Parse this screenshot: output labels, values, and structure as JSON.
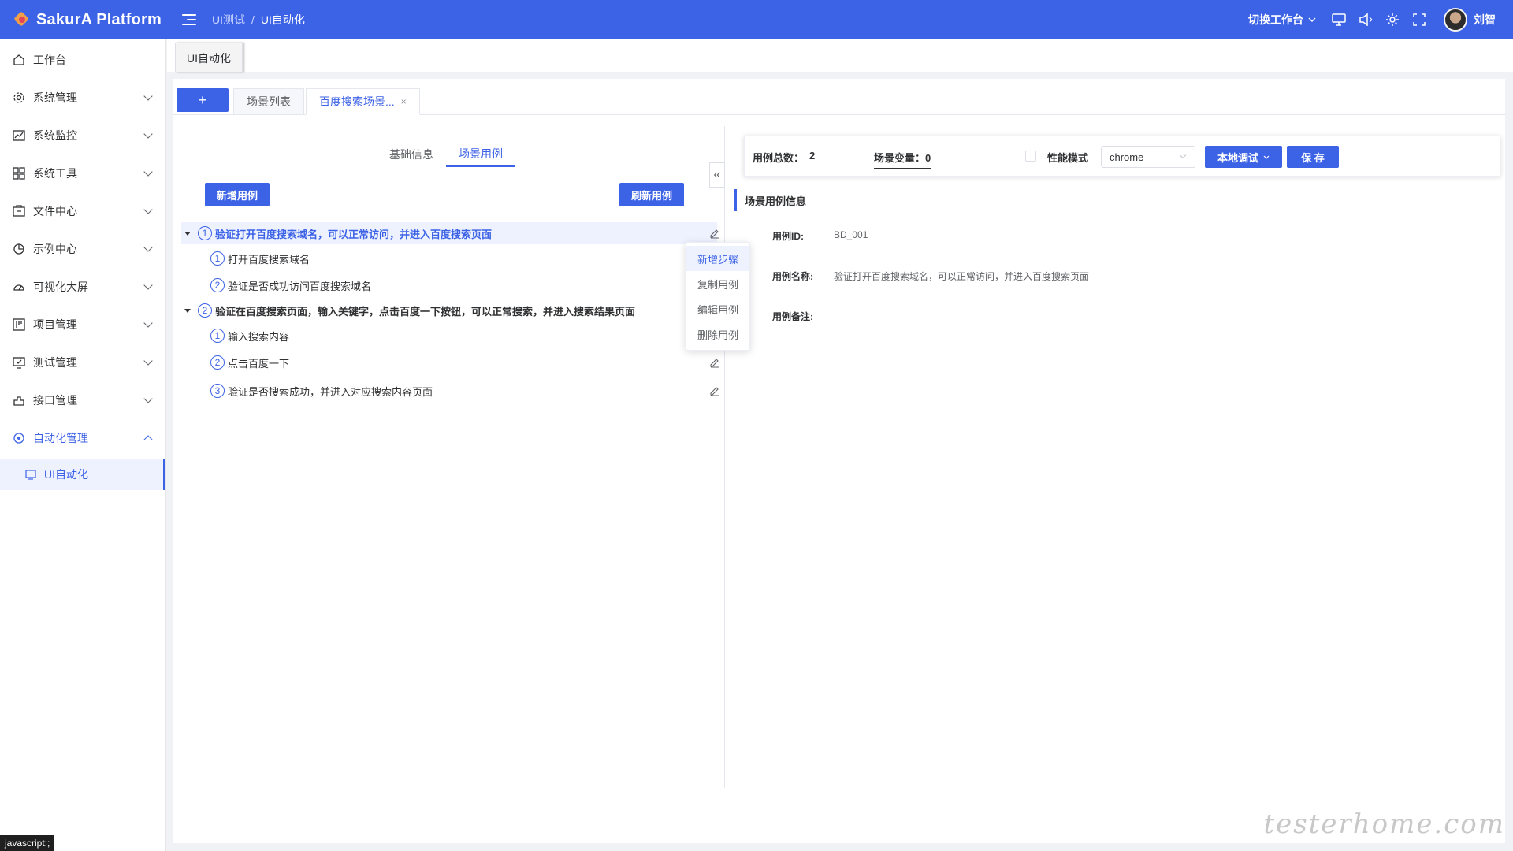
{
  "header": {
    "logo_text": "SakurA Platform",
    "breadcrumb": [
      "UI测试",
      "/",
      "UI自动化"
    ],
    "workspace_switch": "切换工作台",
    "username": "刘智",
    "icons": [
      "monitor-icon",
      "speaker-icon",
      "gear-icon",
      "fullscreen-icon"
    ],
    "accent_color": "#3c62e6"
  },
  "sidebar": {
    "items": [
      {
        "label": "工作台",
        "icon": "home-icon"
      },
      {
        "label": "系统管理",
        "icon": "settings-icon"
      },
      {
        "label": "系统监控",
        "icon": "monitor-chart-icon"
      },
      {
        "label": "系统工具",
        "icon": "grid-icon"
      },
      {
        "label": "文件中心",
        "icon": "file-icon"
      },
      {
        "label": "示例中心",
        "icon": "pie-icon"
      },
      {
        "label": "可视化大屏",
        "icon": "dashboard-icon"
      },
      {
        "label": "项目管理",
        "icon": "project-icon"
      },
      {
        "label": "测试管理",
        "icon": "test-icon"
      },
      {
        "label": "接口管理",
        "icon": "api-icon"
      },
      {
        "label": "自动化管理",
        "icon": "automation-icon"
      }
    ],
    "active_sub": "UI自动化",
    "status_link": "javascript:;"
  },
  "tagsbar": {
    "active_tag": "UI自动化"
  },
  "subtabs": {
    "add": "+",
    "list": "场景列表",
    "active": "百度搜索场景...",
    "close": "×"
  },
  "left": {
    "tabs": [
      "基础信息",
      "场景用例"
    ],
    "add_case": "新增用例",
    "refresh_case": "刷新用例",
    "tree": [
      {
        "num": "1",
        "label": "验证打开百度搜索域名，可以正常访问，并进入百度搜索页面",
        "children": [
          {
            "num": "1",
            "label": "打开百度搜索域名"
          },
          {
            "num": "2",
            "label": "验证是否成功访问百度搜索域名"
          }
        ]
      },
      {
        "num": "2",
        "label": "验证在百度搜索页面，输入关键字，点击百度一下按钮，可以正常搜索，并进入搜索结果页面",
        "children": [
          {
            "num": "1",
            "label": "输入搜索内容"
          },
          {
            "num": "2",
            "label": "点击百度一下"
          },
          {
            "num": "3",
            "label": "验证是否搜索成功，并进入对应搜索内容页面"
          }
        ]
      }
    ],
    "context_menu": [
      "新增步骤",
      "复制用例",
      "编辑用例",
      "删除用例"
    ],
    "collapse": "«"
  },
  "right": {
    "case_total_label": "用例总数：",
    "case_total": "2",
    "scene_var_label": "场景变量：",
    "scene_var": "0",
    "perf_mode": "性能模式",
    "browser": "chrome",
    "local_debug": "本地调试",
    "save": "保 存",
    "section_title": "场景用例信息",
    "case_id_label": "用例ID:",
    "case_id": "BD_001",
    "case_name_label": "用例名称:",
    "case_name": "验证打开百度搜索域名，可以正常访问，并进入百度搜索页面",
    "case_note_label": "用例备注:"
  },
  "watermark": "testerhome.com"
}
